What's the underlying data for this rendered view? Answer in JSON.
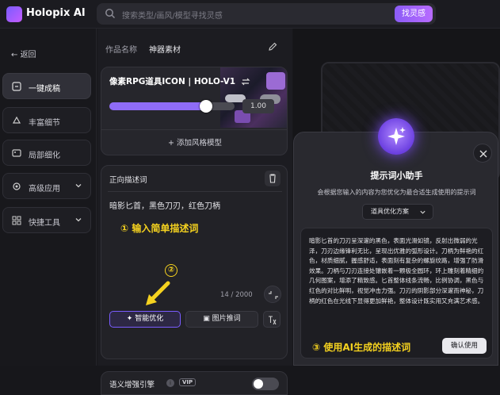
{
  "app": {
    "name": "Holopix AI"
  },
  "search": {
    "placeholder": "搜索类型/画风/模型寻找灵感",
    "button": "找灵感"
  },
  "sidebar": {
    "back": "返回",
    "items": [
      {
        "label": "一键成稿",
        "icon": "wand-icon",
        "active": true
      },
      {
        "label": "丰富细节",
        "icon": "detail-icon"
      },
      {
        "label": "局部细化",
        "icon": "refine-icon"
      },
      {
        "label": "高级应用",
        "icon": "advanced-icon",
        "expandable": true
      },
      {
        "label": "快捷工具",
        "icon": "tools-icon",
        "expandable": true
      }
    ]
  },
  "work": {
    "name_label": "作品名称",
    "name_value": "神器素材"
  },
  "style": {
    "name": "像素RPG道具ICON | HOLO-V1",
    "weight": 1.0,
    "weight_text": "1.00",
    "add": "添加风格模型"
  },
  "prompt": {
    "title": "正向描述词",
    "text": "暗影匕首，黑色刀刃，红色刀柄",
    "counter": "14 / 2000",
    "smart_btn": "智能优化",
    "image_btn": "图片推词"
  },
  "annotations": {
    "step1": "① 输入简单描述词",
    "step2": "②",
    "step3": "③ 使用AI生成的描述词"
  },
  "semantic": {
    "label": "语义增强引擎",
    "badge": "VIP",
    "enabled": false
  },
  "assistant": {
    "title": "提示词小助手",
    "subtitle": "会根据您输入的内容为您优化为最合适生成使用的提示词",
    "select_value": "道具优化方案",
    "result": "暗影匕首的刀刃呈深邃的黑色，表面光滑如镜，反射出微弱的光泽，刀刃边缘锋利无比，呈现出优雅的弧形设计。刀柄为鲜艳的红色，材质细腻，握感舒适，表面刻有复杂的螺旋纹路，增强了防滑效果。刀柄与刀刃连接处镶嵌着一颗极全圆环，环上雕刻着精细的几何图案，增添了精致感。匕首整体线条流畅，比例协调，黑色与红色的对比鲜明，视觉冲击力强。刀刃的阴影部分深邃而神秘，刀柄的红色在光线下显得更加鲜艳，整体设计既实用又充满艺术感。",
    "confirm": "确认使用"
  }
}
